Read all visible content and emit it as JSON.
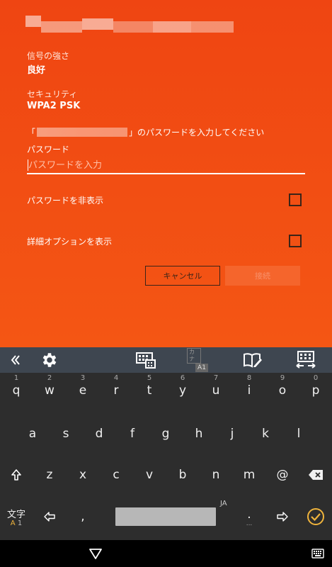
{
  "wifi": {
    "signal_label": "信号の強さ",
    "signal_value": "良好",
    "security_label": "セキュリティ",
    "security_value": "WPA2 PSK",
    "prompt_open": "「",
    "prompt_close": "」のパスワードを入力してください",
    "password_label": "パスワード",
    "password_placeholder": "パスワードを入力",
    "password_value": "",
    "hide_password_label": "パスワードを非表示",
    "hide_password_checked": false,
    "advanced_label": "詳細オプションを表示",
    "advanced_checked": false,
    "cancel_label": "キャンセル",
    "connect_label": "接続"
  },
  "keyboard": {
    "toolbar_kana_top": "カナ",
    "toolbar_kana_bottom": "A1",
    "row1": [
      "q",
      "w",
      "e",
      "r",
      "t",
      "y",
      "u",
      "i",
      "o",
      "p"
    ],
    "row1_nums": [
      "1",
      "2",
      "3",
      "4",
      "5",
      "6",
      "7",
      "8",
      "9",
      "0"
    ],
    "row2": [
      "a",
      "s",
      "d",
      "f",
      "g",
      "h",
      "j",
      "k",
      "l"
    ],
    "row3": [
      "z",
      "x",
      "c",
      "v",
      "b",
      "n",
      "m",
      "@"
    ],
    "mode_key_top": "文字",
    "mode_key_bottom_a": "A",
    "mode_key_bottom_1": "1",
    "comma": ",",
    "period": ".",
    "period_sub": "...",
    "language_tag": "JA"
  },
  "colors": {
    "accent": "#f04a14",
    "keyboard_bg": "#2d2d2d",
    "toolbar_bg": "#3e4650",
    "enter_key": "#f0b43c"
  }
}
